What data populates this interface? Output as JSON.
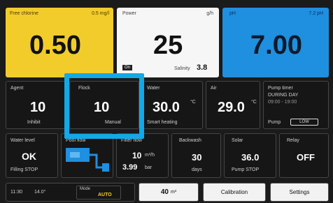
{
  "free_chlorine": {
    "label": "Free chlorine",
    "unit": "0.5 mg/l",
    "value": "0.50"
  },
  "power": {
    "label": "Power",
    "unit": "g/h",
    "value": "25",
    "badge": "On",
    "salinity_label": "Salinity",
    "salinity_value": "3.8"
  },
  "ph": {
    "label": "pH",
    "target": "7.2 pH",
    "value": "7.00"
  },
  "agent": {
    "label": "Agent",
    "value": "10",
    "sub": "Inhibit"
  },
  "flock": {
    "label": "Flock",
    "value": "10",
    "sub": "Manual"
  },
  "water": {
    "label": "Water",
    "value": "30.0",
    "unit": "°C",
    "sub": "Smart heating"
  },
  "air": {
    "label": "Air",
    "value": "29.0",
    "unit": "°C"
  },
  "pump_timer": {
    "label": "Pump timer",
    "line1": "DURING DAY",
    "line2": "09:00 - 19:00",
    "pump_label": "Pump",
    "toggle_label": "LOW"
  },
  "water_level": {
    "label": "Water level",
    "value": "OK",
    "sub": "Filling STOP"
  },
  "flow_schematic": {
    "label": "Pool flow"
  },
  "filter_flow": {
    "label": "Filter flow",
    "value": "10",
    "unit": "m³/h",
    "pressure": "3.99",
    "pressure_unit": "bar"
  },
  "backwash": {
    "label": "Backwash",
    "value": "30",
    "sub": "days"
  },
  "solar": {
    "label": "Solar",
    "value": "36.0",
    "sub": "Pump STOP"
  },
  "relay": {
    "label": "Relay",
    "value": "OFF"
  },
  "status_bar": {
    "time": "11:30",
    "temp": "14.0°",
    "mode_label": "Mode",
    "mode_value": "AUTO"
  },
  "buttons": {
    "volume": "40",
    "volume_unit": "m³",
    "calibration": "Calibration",
    "settings": "Settings"
  },
  "colors": {
    "yellow": "#f2cc2a",
    "blue": "#1f8fe0",
    "highlight": "#12a9e6",
    "background": "#1b1b1b"
  }
}
